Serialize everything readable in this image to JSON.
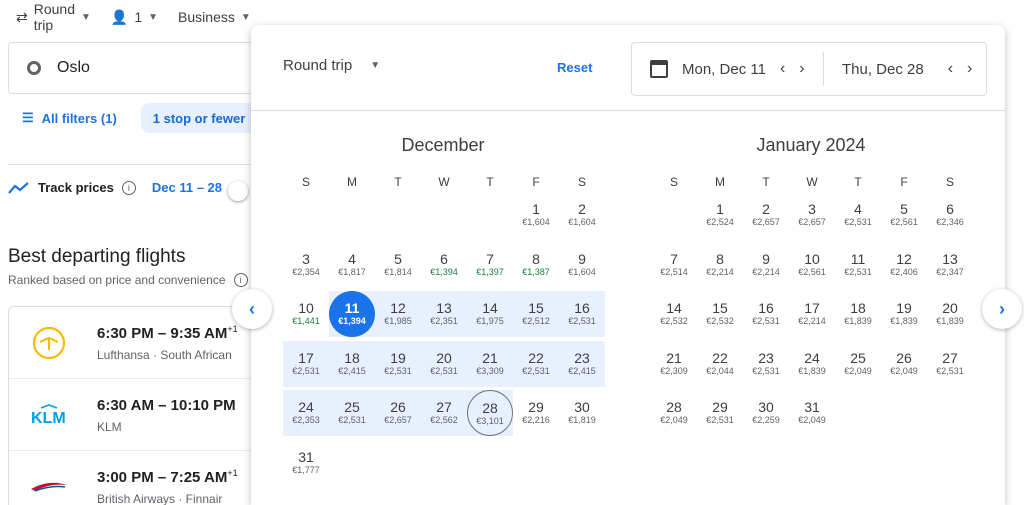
{
  "topbar": {
    "trip_type": "Round trip",
    "passengers": "1",
    "cabin": "Business"
  },
  "origin": "Oslo",
  "filters": {
    "all": "All filters (1)",
    "chip": "1 stop or fewer"
  },
  "track": {
    "label": "Track prices",
    "dates": "Dec 11 – 28"
  },
  "results": {
    "title": "Best departing flights",
    "ranked": "Ranked based on price and convenience",
    "flights": [
      {
        "times": "6:30 PM – 9:35 AM",
        "plus": "+1",
        "airline": "Lufthansa · South African",
        "logo": "lufthansa-crane"
      },
      {
        "times": "6:30 AM – 10:10 PM",
        "plus": "",
        "airline": "KLM",
        "logo": "klm-crown"
      },
      {
        "times": "3:00 PM – 7:25 AM",
        "plus": "+1",
        "airline": "British Airways · Finnair",
        "logo": "ba-speedmarque"
      }
    ]
  },
  "popup": {
    "trip_type": "Round trip",
    "reset": "Reset",
    "depart": "Mon, Dec 11",
    "return": "Thu, Dec 28",
    "weekdays": [
      "S",
      "M",
      "T",
      "W",
      "T",
      "F",
      "S"
    ],
    "months": [
      {
        "title": "December",
        "days": [
          {
            "d": "1",
            "p": "€1,604",
            "col": 5,
            "row": 0
          },
          {
            "d": "2",
            "p": "€1,604",
            "col": 6,
            "row": 0
          },
          {
            "d": "3",
            "p": "€2,354",
            "col": 0,
            "row": 1
          },
          {
            "d": "4",
            "p": "€1,817",
            "col": 1,
            "row": 1
          },
          {
            "d": "5",
            "p": "€1,814",
            "col": 2,
            "row": 1
          },
          {
            "d": "6",
            "p": "€1,394",
            "col": 3,
            "row": 1,
            "low": true
          },
          {
            "d": "7",
            "p": "€1,397",
            "col": 4,
            "row": 1,
            "low": true
          },
          {
            "d": "8",
            "p": "€1,387",
            "col": 5,
            "row": 1,
            "low": true
          },
          {
            "d": "9",
            "p": "€1,604",
            "col": 6,
            "row": 1
          },
          {
            "d": "10",
            "p": "€1,441",
            "col": 0,
            "row": 2,
            "low": true
          },
          {
            "d": "11",
            "p": "€1,394",
            "col": 1,
            "row": 2,
            "sel": true
          },
          {
            "d": "12",
            "p": "€1,985",
            "col": 2,
            "row": 2
          },
          {
            "d": "13",
            "p": "€2,351",
            "col": 3,
            "row": 2
          },
          {
            "d": "14",
            "p": "€1,975",
            "col": 4,
            "row": 2
          },
          {
            "d": "15",
            "p": "€2,512",
            "col": 5,
            "row": 2
          },
          {
            "d": "16",
            "p": "€2,531",
            "col": 6,
            "row": 2
          },
          {
            "d": "17",
            "p": "€2,531",
            "col": 0,
            "row": 3
          },
          {
            "d": "18",
            "p": "€2,415",
            "col": 1,
            "row": 3
          },
          {
            "d": "19",
            "p": "€2,531",
            "col": 2,
            "row": 3
          },
          {
            "d": "20",
            "p": "€2,531",
            "col": 3,
            "row": 3
          },
          {
            "d": "21",
            "p": "€3,309",
            "col": 4,
            "row": 3
          },
          {
            "d": "22",
            "p": "€2,531",
            "col": 5,
            "row": 3
          },
          {
            "d": "23",
            "p": "€2,415",
            "col": 6,
            "row": 3
          },
          {
            "d": "24",
            "p": "€2,353",
            "col": 0,
            "row": 4
          },
          {
            "d": "25",
            "p": "€2,531",
            "col": 1,
            "row": 4
          },
          {
            "d": "26",
            "p": "€2,657",
            "col": 2,
            "row": 4
          },
          {
            "d": "27",
            "p": "€2,562",
            "col": 3,
            "row": 4
          },
          {
            "d": "28",
            "p": "€3,101",
            "col": 4,
            "row": 4,
            "ret": true
          },
          {
            "d": "29",
            "p": "€2,216",
            "col": 5,
            "row": 4
          },
          {
            "d": "30",
            "p": "€1,819",
            "col": 6,
            "row": 4
          },
          {
            "d": "31",
            "p": "€1,777",
            "col": 0,
            "row": 5
          }
        ]
      },
      {
        "title": "January 2024",
        "days": [
          {
            "d": "1",
            "p": "€2,524",
            "col": 1,
            "row": 0
          },
          {
            "d": "2",
            "p": "€2,657",
            "col": 2,
            "row": 0
          },
          {
            "d": "3",
            "p": "€2,657",
            "col": 3,
            "row": 0
          },
          {
            "d": "4",
            "p": "€2,531",
            "col": 4,
            "row": 0
          },
          {
            "d": "5",
            "p": "€2,561",
            "col": 5,
            "row": 0
          },
          {
            "d": "6",
            "p": "€2,346",
            "col": 6,
            "row": 0
          },
          {
            "d": "7",
            "p": "€2,514",
            "col": 0,
            "row": 1
          },
          {
            "d": "8",
            "p": "€2,214",
            "col": 1,
            "row": 1
          },
          {
            "d": "9",
            "p": "€2,214",
            "col": 2,
            "row": 1
          },
          {
            "d": "10",
            "p": "€2,561",
            "col": 3,
            "row": 1
          },
          {
            "d": "11",
            "p": "€2,531",
            "col": 4,
            "row": 1
          },
          {
            "d": "12",
            "p": "€2,406",
            "col": 5,
            "row": 1
          },
          {
            "d": "13",
            "p": "€2,347",
            "col": 6,
            "row": 1
          },
          {
            "d": "14",
            "p": "€2,532",
            "col": 0,
            "row": 2
          },
          {
            "d": "15",
            "p": "€2,532",
            "col": 1,
            "row": 2
          },
          {
            "d": "16",
            "p": "€2,531",
            "col": 2,
            "row": 2
          },
          {
            "d": "17",
            "p": "€2,214",
            "col": 3,
            "row": 2
          },
          {
            "d": "18",
            "p": "€1,839",
            "col": 4,
            "row": 2
          },
          {
            "d": "19",
            "p": "€1,839",
            "col": 5,
            "row": 2
          },
          {
            "d": "20",
            "p": "€1,839",
            "col": 6,
            "row": 2
          },
          {
            "d": "21",
            "p": "€2,309",
            "col": 0,
            "row": 3
          },
          {
            "d": "22",
            "p": "€2,044",
            "col": 1,
            "row": 3
          },
          {
            "d": "23",
            "p": "€2,531",
            "col": 2,
            "row": 3
          },
          {
            "d": "24",
            "p": "€1,839",
            "col": 3,
            "row": 3
          },
          {
            "d": "25",
            "p": "€2,049",
            "col": 4,
            "row": 3
          },
          {
            "d": "26",
            "p": "€2,049",
            "col": 5,
            "row": 3
          },
          {
            "d": "27",
            "p": "€2,531",
            "col": 6,
            "row": 3
          },
          {
            "d": "28",
            "p": "€2,049",
            "col": 0,
            "row": 4
          },
          {
            "d": "29",
            "p": "€2,531",
            "col": 1,
            "row": 4
          },
          {
            "d": "30",
            "p": "€2,259",
            "col": 2,
            "row": 4
          },
          {
            "d": "31",
            "p": "€2,049",
            "col": 3,
            "row": 4
          }
        ]
      }
    ]
  },
  "colors": {
    "accent": "#1a73e8",
    "range": "#e8f0fe",
    "low_price": "#188038"
  }
}
